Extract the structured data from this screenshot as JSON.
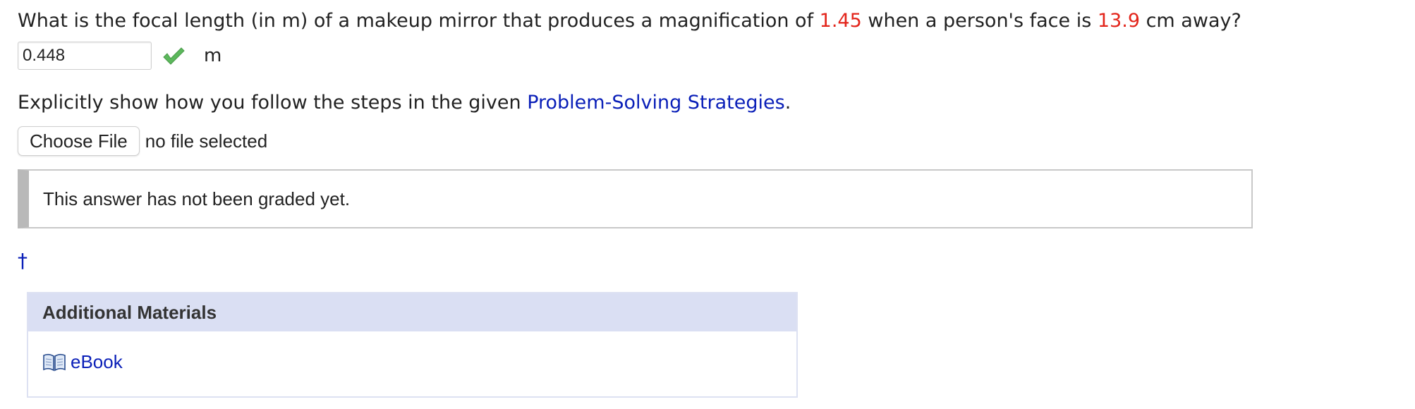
{
  "question": {
    "prefix": "What is the focal length (in m) of a makeup mirror that produces a magnification of ",
    "magnification": "1.45",
    "middle": " when a person's face is ",
    "distance": "13.9",
    "suffix": " cm away?"
  },
  "answer": {
    "value": "0.448",
    "unit": "m",
    "status_icon": "check-icon"
  },
  "instructions": {
    "prefix": "Explicitly show how you follow the steps in the given ",
    "link": "Problem-Solving Strategies",
    "suffix": "."
  },
  "file_upload": {
    "button_label": "Choose File",
    "status": "no file selected"
  },
  "grading": {
    "message": "This answer has not been graded yet."
  },
  "footnote": {
    "symbol": "†"
  },
  "additional_materials": {
    "title": "Additional Materials",
    "items": [
      {
        "label": "eBook",
        "icon": "book-icon"
      }
    ]
  },
  "colors": {
    "highlight": "#e3251b",
    "link": "#0a1fb8",
    "check": "#5cb85c",
    "materials_header": "#dadff3"
  }
}
